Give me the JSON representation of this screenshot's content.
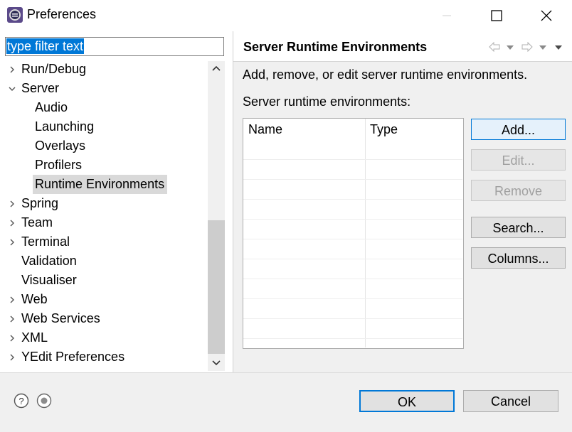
{
  "window": {
    "title": "Preferences"
  },
  "filter": {
    "text": "type filter text"
  },
  "tree": {
    "items": [
      {
        "label": "Run/Debug",
        "expand": "collapsed",
        "indent": 0
      },
      {
        "label": "Server",
        "expand": "expanded",
        "indent": 0
      },
      {
        "label": "Audio",
        "expand": "none",
        "indent": 1
      },
      {
        "label": "Launching",
        "expand": "none",
        "indent": 1
      },
      {
        "label": "Overlays",
        "expand": "none",
        "indent": 1
      },
      {
        "label": "Profilers",
        "expand": "none",
        "indent": 1
      },
      {
        "label": "Runtime Environments",
        "expand": "none",
        "indent": 1,
        "selected": true
      },
      {
        "label": "Spring",
        "expand": "collapsed",
        "indent": 0
      },
      {
        "label": "Team",
        "expand": "collapsed",
        "indent": 0
      },
      {
        "label": "Terminal",
        "expand": "collapsed",
        "indent": 0
      },
      {
        "label": "Validation",
        "expand": "none",
        "indent": 0
      },
      {
        "label": "Visualiser",
        "expand": "none",
        "indent": 0
      },
      {
        "label": "Web",
        "expand": "collapsed",
        "indent": 0
      },
      {
        "label": "Web Services",
        "expand": "collapsed",
        "indent": 0
      },
      {
        "label": "XML",
        "expand": "collapsed",
        "indent": 0
      },
      {
        "label": "YEdit Preferences",
        "expand": "collapsed",
        "indent": 0
      }
    ]
  },
  "page": {
    "title": "Server Runtime Environments",
    "description": "Add, remove, or edit server runtime environments.",
    "list_label": "Server runtime environments:",
    "columns": [
      "Name",
      "Type"
    ]
  },
  "buttons": {
    "add": "Add...",
    "edit": "Edit...",
    "remove": "Remove",
    "search": "Search...",
    "columns": "Columns..."
  },
  "footer": {
    "ok": "OK",
    "cancel": "Cancel"
  },
  "colors": {
    "selection": "#0078d7",
    "tree_selected": "#d9d9d9",
    "panel": "#f0f0f0"
  }
}
